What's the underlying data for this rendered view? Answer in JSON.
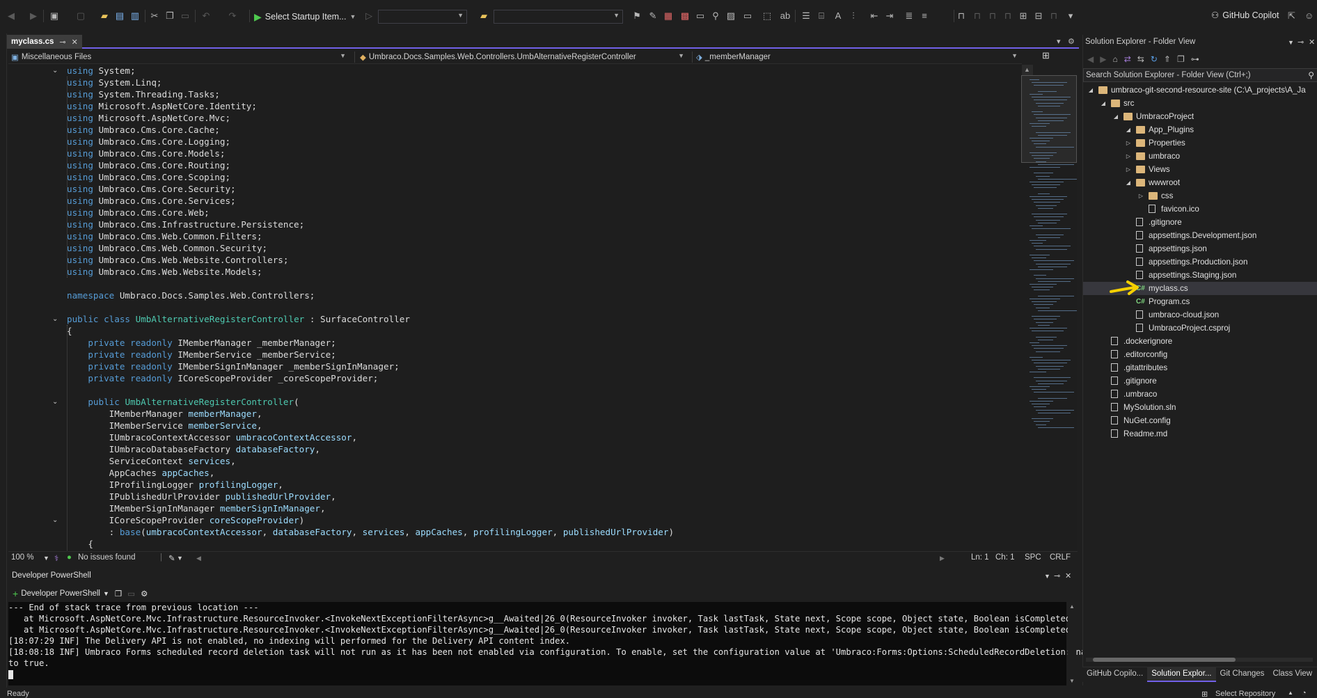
{
  "toolbar": {
    "startup_label": "Select Startup Item...",
    "copilot_label": "GitHub Copilot"
  },
  "document": {
    "tab_title": "myclass.cs",
    "nav_project": "Miscellaneous Files",
    "nav_type": "Umbraco.Docs.Samples.Web.Controllers.UmbAlternativeRegisterController",
    "nav_member": "_memberManager"
  },
  "editor_status": {
    "zoom": "100 %",
    "issues": "No issues found",
    "line": "Ln: 1",
    "col": "Ch: 1",
    "whitespace": "SPC",
    "line_ending": "CRLF"
  },
  "powershell": {
    "title": "Developer PowerShell",
    "profile_label": "Developer PowerShell",
    "lines": [
      "--- End of stack trace from previous location ---",
      "   at Microsoft.AspNetCore.Mvc.Infrastructure.ResourceInvoker.<InvokeNextExceptionFilterAsync>g__Awaited|26_0(ResourceInvoker invoker, Task lastTask, State next, Scope scope, Object state, Boolean isCompleted)",
      "   at Microsoft.AspNetCore.Mvc.Infrastructure.ResourceInvoker.<InvokeNextExceptionFilterAsync>g__Awaited|26_0(ResourceInvoker invoker, Task lastTask, State next, Scope scope, Object state, Boolean isCompleted)",
      "[18:07:29 INF] The Delivery API is not enabled, no indexing will performed for the Delivery API content index.",
      "[18:08:18 INF] Umbraco Forms scheduled record deletion task will not run as it has been not enabled via configuration. To enable, set the configuration value at 'Umbraco:Forms:Options:ScheduledRecordDeletion:Enabled'",
      "to true."
    ]
  },
  "status": {
    "ready": "Ready",
    "repo": "Select Repository"
  },
  "solution_explorer": {
    "title": "Solution Explorer - Folder View",
    "search_placeholder": "Search Solution Explorer - Folder View (Ctrl+;)",
    "tabs": [
      "GitHub Copilo...",
      "Solution Explor...",
      "Git Changes",
      "Class View"
    ],
    "tree": [
      {
        "label": "umbraco-git-second-resource-site (C:\\A_projects\\A_Ja",
        "kind": "folder",
        "level": 0,
        "expand": "open"
      },
      {
        "label": "src",
        "kind": "folder",
        "level": 1,
        "expand": "open"
      },
      {
        "label": "UmbracoProject",
        "kind": "folder",
        "level": 2,
        "expand": "open"
      },
      {
        "label": "App_Plugins",
        "kind": "folder",
        "level": 3,
        "expand": "open"
      },
      {
        "label": "Properties",
        "kind": "folder",
        "level": 3,
        "expand": "closed"
      },
      {
        "label": "umbraco",
        "kind": "folder",
        "level": 3,
        "expand": "closed"
      },
      {
        "label": "Views",
        "kind": "folder",
        "level": 3,
        "expand": "closed"
      },
      {
        "label": "wwwroot",
        "kind": "folder",
        "level": 3,
        "expand": "open"
      },
      {
        "label": "css",
        "kind": "folder",
        "level": 4,
        "expand": "closed"
      },
      {
        "label": "favicon.ico",
        "kind": "file",
        "level": 4,
        "expand": ""
      },
      {
        "label": ".gitignore",
        "kind": "file",
        "level": 3,
        "expand": ""
      },
      {
        "label": "appsettings.Development.json",
        "kind": "file",
        "level": 3,
        "expand": ""
      },
      {
        "label": "appsettings.json",
        "kind": "file",
        "level": 3,
        "expand": ""
      },
      {
        "label": "appsettings.Production.json",
        "kind": "file",
        "level": 3,
        "expand": ""
      },
      {
        "label": "appsettings.Staging.json",
        "kind": "file",
        "level": 3,
        "expand": ""
      },
      {
        "label": "myclass.cs",
        "kind": "cs",
        "level": 3,
        "expand": "",
        "selected": true
      },
      {
        "label": "Program.cs",
        "kind": "cs",
        "level": 3,
        "expand": ""
      },
      {
        "label": "umbraco-cloud.json",
        "kind": "file",
        "level": 3,
        "expand": ""
      },
      {
        "label": "UmbracoProject.csproj",
        "kind": "file",
        "level": 3,
        "expand": ""
      },
      {
        "label": ".dockerignore",
        "kind": "file",
        "level": 1,
        "expand": ""
      },
      {
        "label": ".editorconfig",
        "kind": "file",
        "level": 1,
        "expand": ""
      },
      {
        "label": ".gitattributes",
        "kind": "file",
        "level": 1,
        "expand": ""
      },
      {
        "label": ".gitignore",
        "kind": "file",
        "level": 1,
        "expand": ""
      },
      {
        "label": ".umbraco",
        "kind": "file",
        "level": 1,
        "expand": ""
      },
      {
        "label": "MySolution.sln",
        "kind": "file",
        "level": 1,
        "expand": ""
      },
      {
        "label": "NuGet.config",
        "kind": "file",
        "level": 1,
        "expand": ""
      },
      {
        "label": "Readme.md",
        "kind": "file",
        "level": 1,
        "expand": ""
      }
    ]
  },
  "code": [
    [
      [
        "kw",
        "using"
      ],
      [
        "plain",
        " System;"
      ]
    ],
    [
      [
        "kw",
        "using"
      ],
      [
        "plain",
        " System.Linq;"
      ]
    ],
    [
      [
        "kw",
        "using"
      ],
      [
        "plain",
        " System.Threading.Tasks;"
      ]
    ],
    [
      [
        "kw",
        "using"
      ],
      [
        "plain",
        " Microsoft.AspNetCore.Identity;"
      ]
    ],
    [
      [
        "kw",
        "using"
      ],
      [
        "plain",
        " Microsoft.AspNetCore.Mvc;"
      ]
    ],
    [
      [
        "kw",
        "using"
      ],
      [
        "plain",
        " Umbraco.Cms.Core.Cache;"
      ]
    ],
    [
      [
        "kw",
        "using"
      ],
      [
        "plain",
        " Umbraco.Cms.Core.Logging;"
      ]
    ],
    [
      [
        "kw",
        "using"
      ],
      [
        "plain",
        " Umbraco.Cms.Core.Models;"
      ]
    ],
    [
      [
        "kw",
        "using"
      ],
      [
        "plain",
        " Umbraco.Cms.Core.Routing;"
      ]
    ],
    [
      [
        "kw",
        "using"
      ],
      [
        "plain",
        " Umbraco.Cms.Core.Scoping;"
      ]
    ],
    [
      [
        "kw",
        "using"
      ],
      [
        "plain",
        " Umbraco.Cms.Core.Security;"
      ]
    ],
    [
      [
        "kw",
        "using"
      ],
      [
        "plain",
        " Umbraco.Cms.Core.Services;"
      ]
    ],
    [
      [
        "kw",
        "using"
      ],
      [
        "plain",
        " Umbraco.Cms.Core.Web;"
      ]
    ],
    [
      [
        "kw",
        "using"
      ],
      [
        "plain",
        " Umbraco.Cms.Infrastructure.Persistence;"
      ]
    ],
    [
      [
        "kw",
        "using"
      ],
      [
        "plain",
        " Umbraco.Cms.Web.Common.Filters;"
      ]
    ],
    [
      [
        "kw",
        "using"
      ],
      [
        "plain",
        " Umbraco.Cms.Web.Common.Security;"
      ]
    ],
    [
      [
        "kw",
        "using"
      ],
      [
        "plain",
        " Umbraco.Cms.Web.Website.Controllers;"
      ]
    ],
    [
      [
        "kw",
        "using"
      ],
      [
        "plain",
        " Umbraco.Cms.Web.Website.Models;"
      ]
    ],
    [],
    [
      [
        "kw",
        "namespace"
      ],
      [
        "plain",
        " Umbraco.Docs.Samples.Web.Controllers;"
      ]
    ],
    [],
    [
      [
        "kw",
        "public"
      ],
      [
        "plain",
        " "
      ],
      [
        "kw",
        "class"
      ],
      [
        "plain",
        " "
      ],
      [
        "cls",
        "UmbAlternativeRegisterController"
      ],
      [
        "plain",
        " : "
      ],
      [
        "plain",
        "SurfaceController"
      ]
    ],
    [
      [
        "plain",
        "{"
      ]
    ],
    [
      [
        "plain",
        "    "
      ],
      [
        "kw",
        "private"
      ],
      [
        "plain",
        " "
      ],
      [
        "kw",
        "readonly"
      ],
      [
        "plain",
        " IMemberManager _memberManager;"
      ]
    ],
    [
      [
        "plain",
        "    "
      ],
      [
        "kw",
        "private"
      ],
      [
        "plain",
        " "
      ],
      [
        "kw",
        "readonly"
      ],
      [
        "plain",
        " IMemberService _memberService;"
      ]
    ],
    [
      [
        "plain",
        "    "
      ],
      [
        "kw",
        "private"
      ],
      [
        "plain",
        " "
      ],
      [
        "kw",
        "readonly"
      ],
      [
        "plain",
        " IMemberSignInManager _memberSignInManager;"
      ]
    ],
    [
      [
        "plain",
        "    "
      ],
      [
        "kw",
        "private"
      ],
      [
        "plain",
        " "
      ],
      [
        "kw",
        "readonly"
      ],
      [
        "plain",
        " ICoreScopeProvider _coreScopeProvider;"
      ]
    ],
    [],
    [
      [
        "plain",
        "    "
      ],
      [
        "kw",
        "public"
      ],
      [
        "plain",
        " "
      ],
      [
        "cls",
        "UmbAlternativeRegisterController"
      ],
      [
        "plain",
        "("
      ]
    ],
    [
      [
        "plain",
        "        IMemberManager "
      ],
      [
        "param",
        "memberManager"
      ],
      [
        "plain",
        ","
      ]
    ],
    [
      [
        "plain",
        "        IMemberService "
      ],
      [
        "param",
        "memberService"
      ],
      [
        "plain",
        ","
      ]
    ],
    [
      [
        "plain",
        "        IUmbracoContextAccessor "
      ],
      [
        "param",
        "umbracoContextAccessor"
      ],
      [
        "plain",
        ","
      ]
    ],
    [
      [
        "plain",
        "        IUmbracoDatabaseFactory "
      ],
      [
        "param",
        "databaseFactory"
      ],
      [
        "plain",
        ","
      ]
    ],
    [
      [
        "plain",
        "        ServiceContext "
      ],
      [
        "param",
        "services"
      ],
      [
        "plain",
        ","
      ]
    ],
    [
      [
        "plain",
        "        AppCaches "
      ],
      [
        "param",
        "appCaches"
      ],
      [
        "plain",
        ","
      ]
    ],
    [
      [
        "plain",
        "        IProfilingLogger "
      ],
      [
        "param",
        "profilingLogger"
      ],
      [
        "plain",
        ","
      ]
    ],
    [
      [
        "plain",
        "        IPublishedUrlProvider "
      ],
      [
        "param",
        "publishedUrlProvider"
      ],
      [
        "plain",
        ","
      ]
    ],
    [
      [
        "plain",
        "        IMemberSignInManager "
      ],
      [
        "param",
        "memberSignInManager"
      ],
      [
        "plain",
        ","
      ]
    ],
    [
      [
        "plain",
        "        ICoreScopeProvider "
      ],
      [
        "param",
        "coreScopeProvider"
      ],
      [
        "plain",
        ")"
      ]
    ],
    [
      [
        "plain",
        "        : "
      ],
      [
        "kw",
        "base"
      ],
      [
        "plain",
        "("
      ],
      [
        "param",
        "umbracoContextAccessor"
      ],
      [
        "plain",
        ", "
      ],
      [
        "param",
        "databaseFactory"
      ],
      [
        "plain",
        ", "
      ],
      [
        "param",
        "services"
      ],
      [
        "plain",
        ", "
      ],
      [
        "param",
        "appCaches"
      ],
      [
        "plain",
        ", "
      ],
      [
        "param",
        "profilingLogger"
      ],
      [
        "plain",
        ", "
      ],
      [
        "param",
        "publishedUrlProvider"
      ],
      [
        "plain",
        ")"
      ]
    ],
    [
      [
        "plain",
        "    {"
      ]
    ]
  ]
}
